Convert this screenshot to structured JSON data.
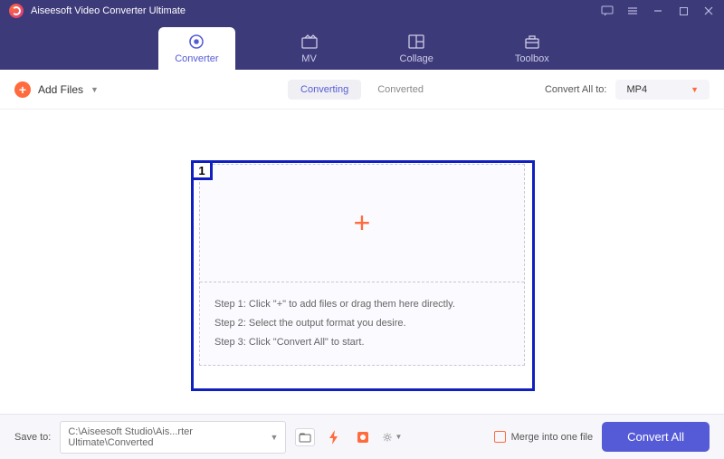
{
  "titlebar": {
    "title": "Aiseesoft Video Converter Ultimate"
  },
  "tabs": {
    "converter": "Converter",
    "mv": "MV",
    "collage": "Collage",
    "toolbox": "Toolbox"
  },
  "toolbar": {
    "add_files": "Add Files",
    "converting": "Converting",
    "converted": "Converted",
    "convert_all_to": "Convert All to:",
    "format": "MP4"
  },
  "highlight": {
    "num": "1"
  },
  "dropzone": {
    "step1": "Step 1: Click \"+\" to add files or drag them here directly.",
    "step2": "Step 2: Select the output format you desire.",
    "step3": "Step 3: Click \"Convert All\" to start."
  },
  "footer": {
    "save_to": "Save to:",
    "path": "C:\\Aiseesoft Studio\\Ais...rter Ultimate\\Converted",
    "merge": "Merge into one file",
    "convert_all": "Convert All"
  }
}
